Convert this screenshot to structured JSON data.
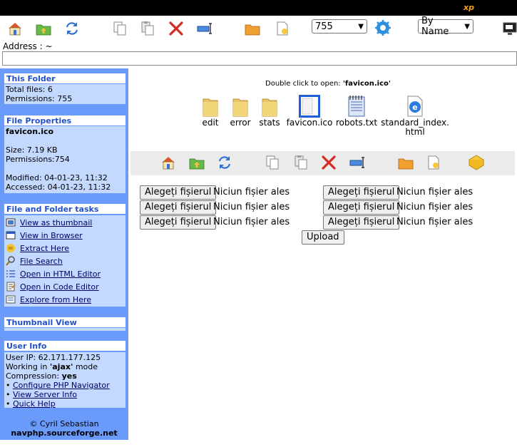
{
  "brand": "xp",
  "toolbar": {
    "icons": [
      "home-icon",
      "up-folder-icon",
      "refresh-icon",
      "copy-icon",
      "paste-icon",
      "delete-icon",
      "rename-icon",
      "new-folder-icon",
      "new-file-icon"
    ],
    "perm_select": "755",
    "sort_select": "By Name",
    "settings_icon": "settings-gear-icon",
    "view_icon": "monitor-icon"
  },
  "address": {
    "label": "Address : ~",
    "value": ""
  },
  "sidebar": {
    "this_folder": {
      "title": "This Folder",
      "total_files": "Total files: 6",
      "permissions": "Permissions: 755"
    },
    "file_properties": {
      "title": "File Properties",
      "name": "favicon.ico",
      "size": "Size: 7.19 KB",
      "permissions": "Permissions:754",
      "modified": "Modified: 04-01-23, 11:32",
      "accessed": "Accessed: 04-01-23, 11:32"
    },
    "tasks": {
      "title": "File and Folder tasks",
      "items": [
        {
          "label": "View as thumbnail",
          "icon": "thumbnail-icon"
        },
        {
          "label": "View in Browser",
          "icon": "browser-icon"
        },
        {
          "label": "Extract Here",
          "icon": "extract-icon"
        },
        {
          "label": "File Search",
          "icon": "search-icon"
        },
        {
          "label": "Open in HTML Editor",
          "icon": "html-editor-icon"
        },
        {
          "label": "Open in Code Editor",
          "icon": "code-editor-icon"
        },
        {
          "label": "Explore from Here",
          "icon": "explore-icon"
        }
      ]
    },
    "thumbnail": {
      "title": "Thumbnail View"
    },
    "user_info": {
      "title": "User Info",
      "ip": "User IP: 62.171.177.125",
      "working_prefix": "Working in ",
      "working_mode": "'ajax'",
      "working_suffix": " mode",
      "compression_prefix": "Compression: ",
      "compression_value": "yes",
      "links": [
        "Configure PHP Navigator",
        "View Server Info",
        "Quick Help"
      ]
    },
    "footer": {
      "copyright": "© Cyril Sebastian",
      "site": "navphp.sourceforge.net"
    }
  },
  "main": {
    "double_click_prefix": "Double click to open: ",
    "double_click_file": "'favicon.ico'",
    "files": [
      {
        "name": "edit",
        "type": "folder"
      },
      {
        "name": "error",
        "type": "folder"
      },
      {
        "name": "stats",
        "type": "folder"
      },
      {
        "name": "favicon.ico",
        "type": "ico"
      },
      {
        "name": "robots.txt",
        "type": "txt"
      },
      {
        "name": "standard_index.html",
        "type": "html",
        "line1": "standard_index.",
        "line2": "html"
      }
    ],
    "upload": {
      "choose_label": "Alegeți fișierul",
      "no_file_label": "Niciun fișier ales",
      "upload_button": "Upload"
    }
  }
}
